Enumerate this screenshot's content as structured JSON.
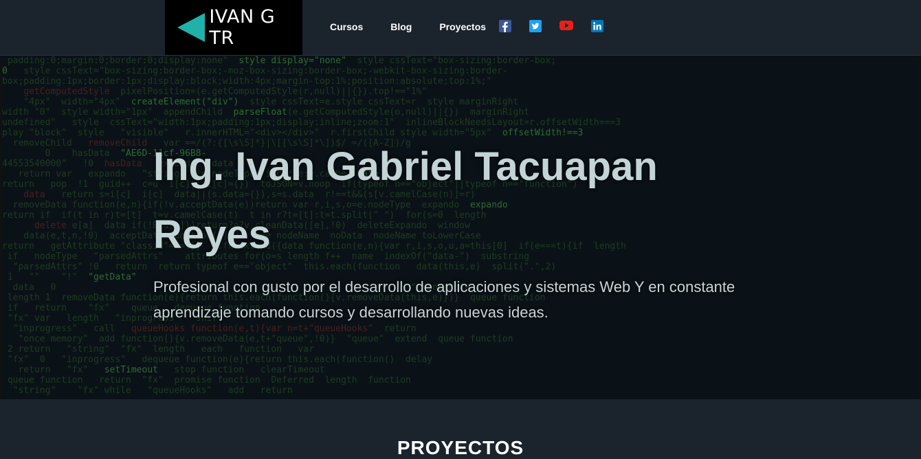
{
  "brand": {
    "name": "IVAN G TR",
    "logo_color": "#20b2aa"
  },
  "nav": {
    "items": [
      "Cursos",
      "Blog",
      "Proyectos"
    ]
  },
  "social": [
    {
      "icon": "facebook-icon",
      "color": "#3b5998"
    },
    {
      "icon": "twitter-icon",
      "color": "#1da1f2"
    },
    {
      "icon": "youtube-icon",
      "color": "#ff0000"
    },
    {
      "icon": "linkedin-icon",
      "color": "#0077b5"
    }
  ],
  "hero": {
    "title": "Ing. Ivan Gabriel Tacuapan Reyes",
    "subtitle": "Profesional con gusto por el desarrollo de aplicaciones y sistemas Web Y en constante aprendizaje tomando cursos y desarrollando nuevas ideas."
  },
  "section": {
    "title": "PROYECTOS"
  }
}
